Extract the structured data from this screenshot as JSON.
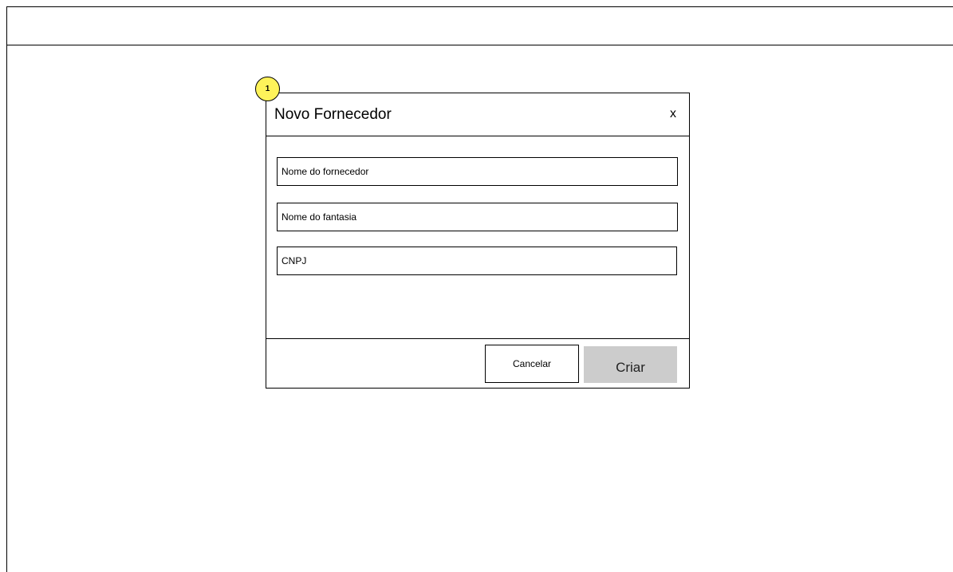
{
  "annotation": {
    "number": "1"
  },
  "modal": {
    "title": "Novo Fornecedor",
    "close_label": "x",
    "fields": [
      {
        "placeholder": "Nome do fornecedor",
        "value": ""
      },
      {
        "placeholder": "Nome do fantasia",
        "value": ""
      },
      {
        "placeholder": "CNPJ",
        "value": ""
      }
    ],
    "cancel_label": "Cancelar",
    "create_label": "Criar"
  },
  "colors": {
    "badge": "#fef35a",
    "primary_button": "#cccccc",
    "border": "#000000"
  },
  "icons": {
    "close": "close-icon"
  }
}
